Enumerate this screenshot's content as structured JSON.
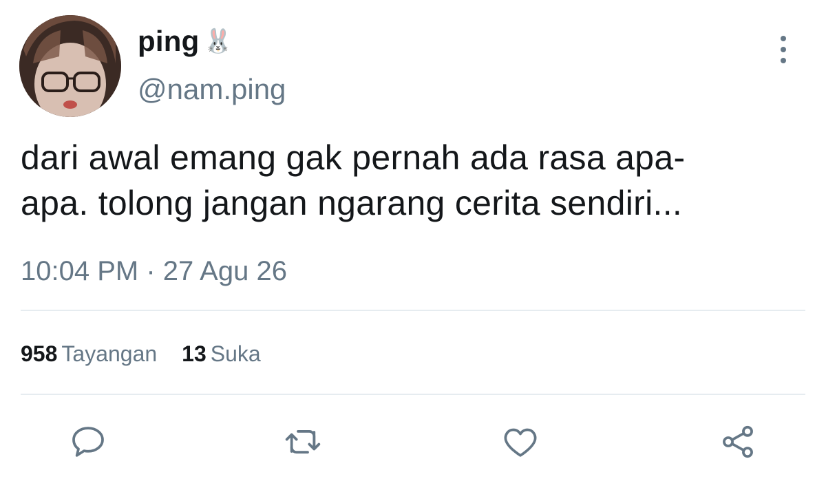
{
  "user": {
    "display_name": "ping",
    "emoji": "🐰",
    "handle": "@nam.ping"
  },
  "tweet": {
    "text_line1": "dari awal emang gak pernah ada rasa apa-",
    "text_line2": "apa. tolong jangan ngarang cerita sendiri...",
    "timestamp": "10:04 PM · 27 Agu 26"
  },
  "stats": {
    "views_count": "958",
    "views_label": "Tayangan",
    "likes_count": "13",
    "likes_label": "Suka"
  },
  "actions": {
    "icons": [
      "reply-icon",
      "retweet-icon",
      "like-icon",
      "share-icon"
    ]
  },
  "colors": {
    "text": "#14171a",
    "secondary": "#657786",
    "divider": "#e6ecf0"
  }
}
